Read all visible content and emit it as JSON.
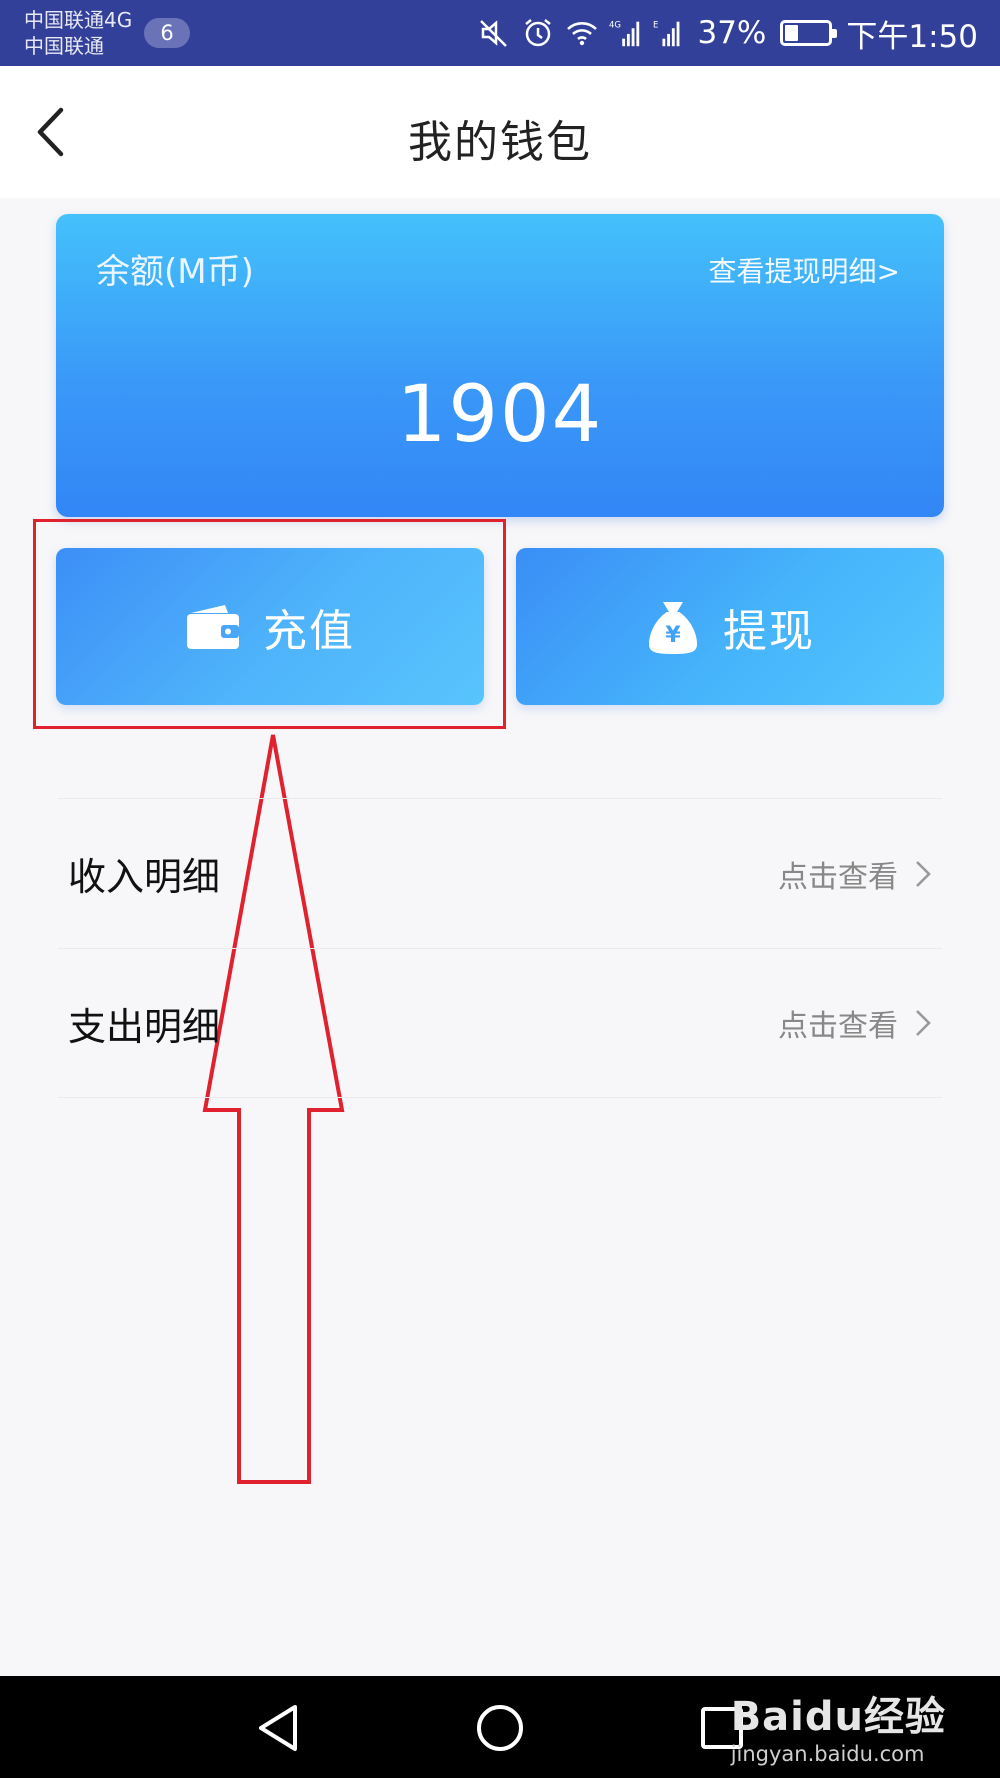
{
  "status_bar": {
    "carrier_1": "中国联通4G",
    "carrier_2": "中国联通",
    "notification_count": "6",
    "battery_percent": "37%",
    "battery_level": 0.37,
    "time": "下午1:50"
  },
  "header": {
    "title": "我的钱包"
  },
  "balance_card": {
    "label": "余额(M币)",
    "withdraw_detail_link": "查看提现明细>",
    "value": "1904"
  },
  "actions": {
    "recharge_label": "充值",
    "withdraw_label": "提现"
  },
  "list": {
    "items": [
      {
        "label": "收入明细",
        "action": "点击查看"
      },
      {
        "label": "支出明细",
        "action": "点击查看"
      }
    ]
  },
  "watermark": {
    "logo": "Baidu经验",
    "url": "jingyan.baidu.com"
  },
  "colors": {
    "status_bar": "#33409a",
    "card_blue": "#3a99f8",
    "annotation_red": "#e0212e"
  }
}
